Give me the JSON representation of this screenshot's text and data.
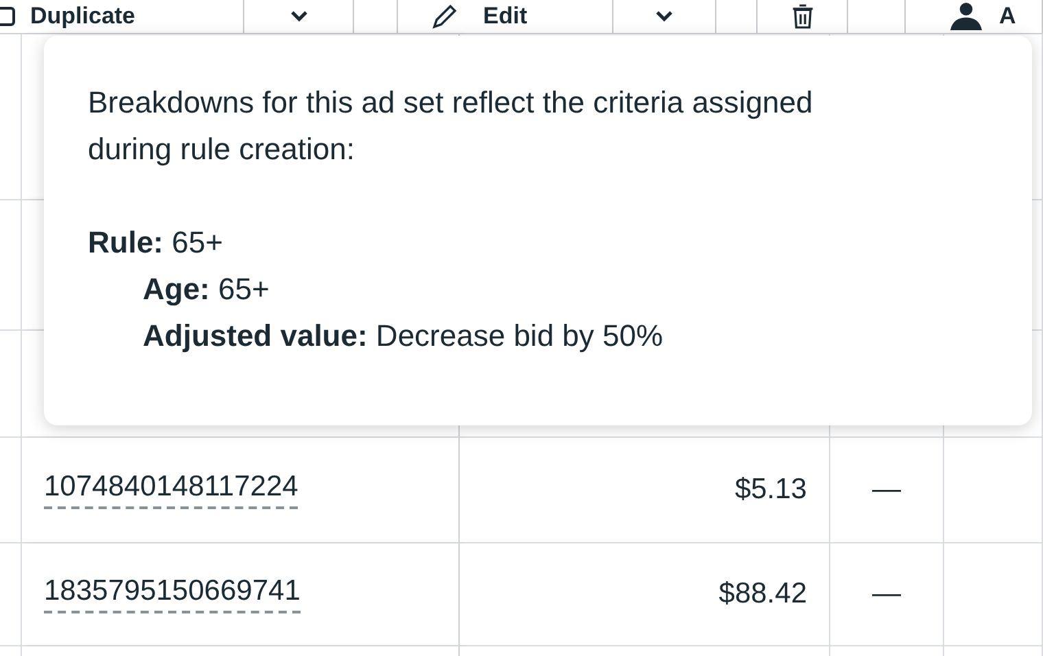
{
  "toolbar": {
    "duplicate_label": "Duplicate",
    "edit_label": "Edit",
    "column_label": "A"
  },
  "tooltip": {
    "intro": "Breakdowns for this ad set reflect the criteria assigned during rule creation:",
    "rule": "**Rule:** 65+",
    "details": [
      "**Age:** 65+",
      "**Adjusted value:** Decrease bid by 50%"
    ]
  },
  "rows": [
    {
      "id": "1074840148117224",
      "amount": "$5.13",
      "column_3": "—"
    },
    {
      "id": "1835795150669741",
      "amount": "$88.42",
      "column_3": "—"
    }
  ]
}
